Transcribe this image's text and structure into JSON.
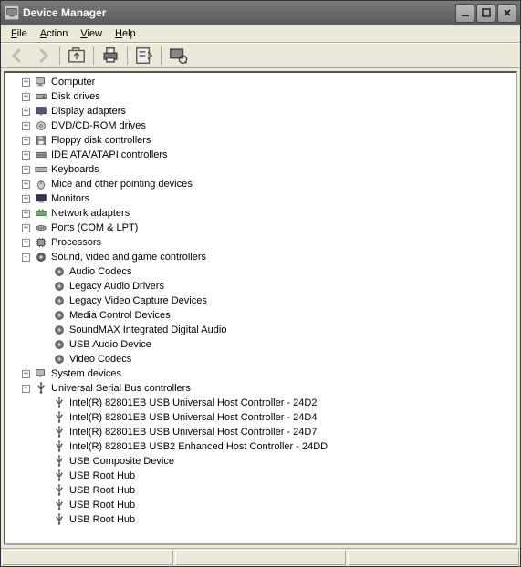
{
  "window": {
    "title": "Device Manager"
  },
  "menus": {
    "file": "File",
    "action": "Action",
    "view": "View",
    "help": "Help"
  },
  "toolbar": {
    "back": "Back",
    "forward": "Forward",
    "up": "Up one level",
    "print": "Print",
    "properties": "Properties",
    "scan": "Scan for hardware changes"
  },
  "tree": [
    {
      "depth": 0,
      "expand": "+",
      "icon": "computer",
      "label": "Computer"
    },
    {
      "depth": 0,
      "expand": "+",
      "icon": "disk",
      "label": "Disk drives"
    },
    {
      "depth": 0,
      "expand": "+",
      "icon": "display",
      "label": "Display adapters"
    },
    {
      "depth": 0,
      "expand": "+",
      "icon": "dvd",
      "label": "DVD/CD-ROM drives"
    },
    {
      "depth": 0,
      "expand": "+",
      "icon": "floppy",
      "label": "Floppy disk controllers"
    },
    {
      "depth": 0,
      "expand": "+",
      "icon": "ide",
      "label": "IDE ATA/ATAPI controllers"
    },
    {
      "depth": 0,
      "expand": "+",
      "icon": "keyboard",
      "label": "Keyboards"
    },
    {
      "depth": 0,
      "expand": "+",
      "icon": "mouse",
      "label": "Mice and other pointing devices"
    },
    {
      "depth": 0,
      "expand": "+",
      "icon": "monitor",
      "label": "Monitors"
    },
    {
      "depth": 0,
      "expand": "+",
      "icon": "network",
      "label": "Network adapters"
    },
    {
      "depth": 0,
      "expand": "+",
      "icon": "ports",
      "label": "Ports (COM & LPT)"
    },
    {
      "depth": 0,
      "expand": "+",
      "icon": "cpu",
      "label": "Processors"
    },
    {
      "depth": 0,
      "expand": "-",
      "icon": "sound",
      "label": "Sound, video and game controllers"
    },
    {
      "depth": 1,
      "expand": "",
      "icon": "sound-dev",
      "label": "Audio Codecs"
    },
    {
      "depth": 1,
      "expand": "",
      "icon": "sound-dev",
      "label": "Legacy Audio Drivers"
    },
    {
      "depth": 1,
      "expand": "",
      "icon": "sound-dev",
      "label": "Legacy Video Capture Devices"
    },
    {
      "depth": 1,
      "expand": "",
      "icon": "sound-dev",
      "label": "Media Control Devices"
    },
    {
      "depth": 1,
      "expand": "",
      "icon": "sound-dev",
      "label": "SoundMAX Integrated Digital Audio"
    },
    {
      "depth": 1,
      "expand": "",
      "icon": "sound-dev",
      "label": "USB Audio Device"
    },
    {
      "depth": 1,
      "expand": "",
      "icon": "sound-dev",
      "label": "Video Codecs"
    },
    {
      "depth": 0,
      "expand": "+",
      "icon": "system",
      "label": "System devices"
    },
    {
      "depth": 0,
      "expand": "-",
      "icon": "usb",
      "label": "Universal Serial Bus controllers"
    },
    {
      "depth": 1,
      "expand": "",
      "icon": "usb-dev",
      "label": "Intel(R) 82801EB USB Universal Host Controller - 24D2"
    },
    {
      "depth": 1,
      "expand": "",
      "icon": "usb-dev",
      "label": "Intel(R) 82801EB USB Universal Host Controller - 24D4"
    },
    {
      "depth": 1,
      "expand": "",
      "icon": "usb-dev",
      "label": "Intel(R) 82801EB USB Universal Host Controller - 24D7"
    },
    {
      "depth": 1,
      "expand": "",
      "icon": "usb-dev",
      "label": "Intel(R) 82801EB USB2 Enhanced Host Controller - 24DD"
    },
    {
      "depth": 1,
      "expand": "",
      "icon": "usb-dev",
      "label": "USB Composite Device"
    },
    {
      "depth": 1,
      "expand": "",
      "icon": "usb-dev",
      "label": "USB Root Hub"
    },
    {
      "depth": 1,
      "expand": "",
      "icon": "usb-dev",
      "label": "USB Root Hub"
    },
    {
      "depth": 1,
      "expand": "",
      "icon": "usb-dev",
      "label": "USB Root Hub"
    },
    {
      "depth": 1,
      "expand": "",
      "icon": "usb-dev",
      "label": "USB Root Hub"
    }
  ]
}
